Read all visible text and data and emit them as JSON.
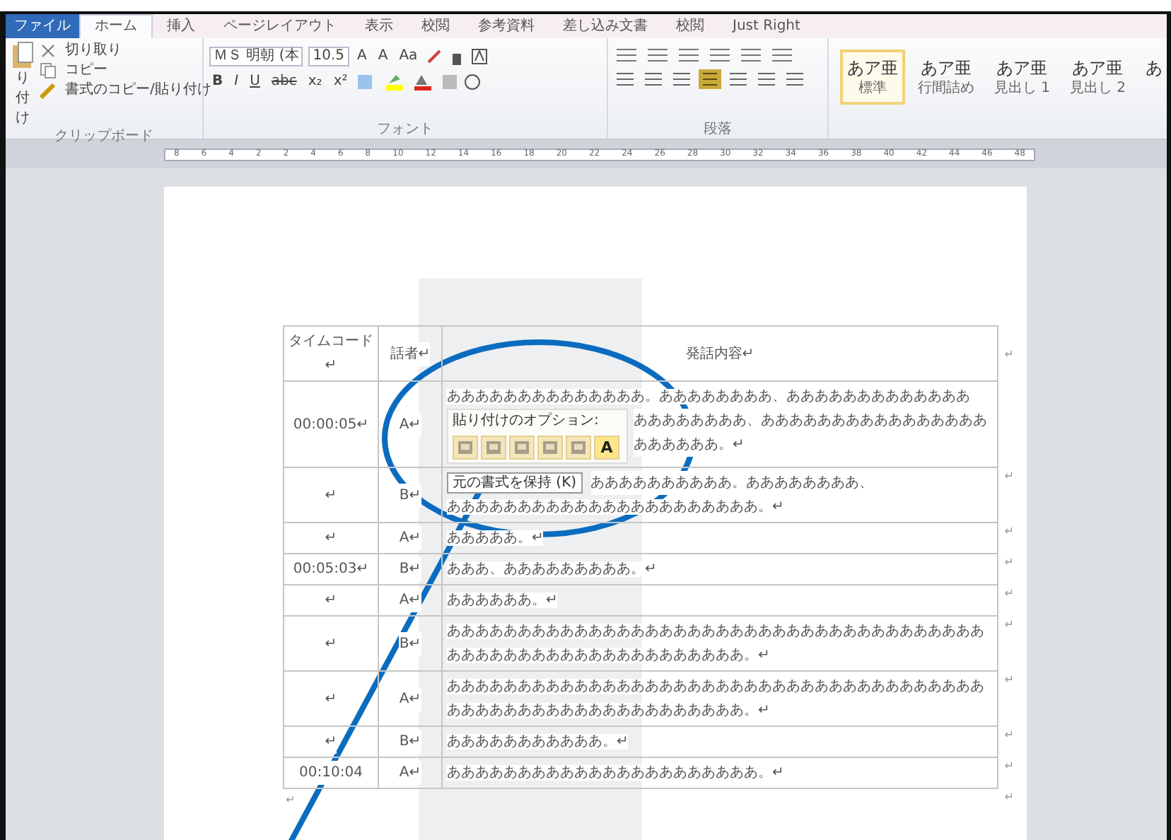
{
  "ribbon_tabs": [
    {
      "label": "ファイル",
      "kind": "file",
      "selected": false
    },
    {
      "label": "ホーム",
      "kind": "tab",
      "selected": true
    },
    {
      "label": "挿入",
      "kind": "tab",
      "selected": false
    },
    {
      "label": "ページレイアウト",
      "kind": "tab",
      "selected": false
    },
    {
      "label": "表示",
      "kind": "tab",
      "selected": false
    },
    {
      "label": "校閲",
      "kind": "tab",
      "selected": false
    },
    {
      "label": "参考資料",
      "kind": "tab",
      "selected": false
    },
    {
      "label": "差し込み文書",
      "kind": "tab",
      "selected": false
    },
    {
      "label": "校閲",
      "kind": "tab",
      "selected": false
    },
    {
      "label": "Just Right",
      "kind": "tab",
      "selected": false
    }
  ],
  "clipboard": {
    "paste_label": "り付け",
    "commands": [
      "切り取り",
      "コピー",
      "書式のコピー/貼り付け"
    ],
    "group_label": "クリップボード"
  },
  "font": {
    "font_name": "ＭＳ 明朝 (本",
    "font_size": "10.5",
    "size_buttons": [
      "A",
      "A",
      "Aa"
    ],
    "format_buttons": [
      "B",
      "I",
      "U",
      "abc",
      "x₂",
      "x²"
    ],
    "group_label": "フォント"
  },
  "paragraph": {
    "group_label": "段落"
  },
  "styles": [
    {
      "sample": "あア亜",
      "label": "標準",
      "selected": true
    },
    {
      "sample": "あア亜",
      "label": "行間詰め",
      "selected": false
    },
    {
      "sample": "あア亜",
      "label": "見出し 1",
      "selected": false
    },
    {
      "sample": "あア亜",
      "label": "見出し 2",
      "selected": false
    },
    {
      "sample": "あ",
      "selected": false
    }
  ],
  "ruler": {
    "numbers": [
      "8",
      "6",
      "4",
      "2",
      "2",
      "4",
      "6",
      "8",
      "10",
      "12",
      "14",
      "16",
      "18",
      "20",
      "22",
      "24",
      "26",
      "28",
      "30",
      "32",
      "34",
      "36",
      "38",
      "40",
      "42",
      "44",
      "46",
      "48"
    ]
  },
  "table": {
    "columns": [
      "タイムコード↵",
      "話者↵",
      "発話内容↵"
    ],
    "rows": [
      {
        "time": "00:00:05↵",
        "speaker": "A↵",
        "lines": [
          {
            "kind": "plain",
            "text": "ああああああああああああああ。ああああああああ、あああああああああああああ"
          },
          {
            "kind": "beside_paste_options",
            "text": "ああああああああ、ああああああああああああああああああああああ。↵"
          }
        ]
      },
      {
        "time": "↵",
        "speaker": "B↵",
        "lines": [
          {
            "kind": "beside_tooltip",
            "text": "ああああああああああ。ああああああああ、"
          },
          {
            "kind": "plain",
            "text": "ああああああああああああああああああああああ。↵"
          }
        ]
      },
      {
        "time": "↵",
        "speaker": "A↵",
        "lines": [
          {
            "kind": "plain",
            "text": "あああああ。↵"
          }
        ]
      },
      {
        "time": "00:05:03↵",
        "speaker": "B↵",
        "lines": [
          {
            "kind": "plain",
            "text": "あああ、あああああああああ。↵"
          }
        ]
      },
      {
        "time": "↵",
        "speaker": "A↵",
        "lines": [
          {
            "kind": "plain",
            "text": "ああああああ。↵"
          }
        ]
      },
      {
        "time": "↵",
        "speaker": "B↵",
        "lines": [
          {
            "kind": "plain",
            "text": "あああああああああああああああああああああああああああああああああああああああああああああああああああああああああああ。↵"
          }
        ]
      },
      {
        "time": "↵",
        "speaker": "A↵",
        "lines": [
          {
            "kind": "plain",
            "text": "あああああああああああああああああああああああああああああああああああああああああああああああああああああああああああ。↵"
          }
        ]
      },
      {
        "time": "↵",
        "speaker": "B↵",
        "lines": [
          {
            "kind": "plain",
            "text": "あああああああああああ。↵"
          }
        ]
      },
      {
        "time": "00:10:04",
        "speaker": "A↵",
        "lines": [
          {
            "kind": "plain",
            "text": "ああああああああああああああああああああああ。↵"
          }
        ]
      }
    ],
    "row_end_mark": "↵"
  },
  "after_table_mark": "↵",
  "paste_options": {
    "title": "貼り付けのオプション:",
    "text_only": "A",
    "tooltip": "元の書式を保持 (K)"
  }
}
